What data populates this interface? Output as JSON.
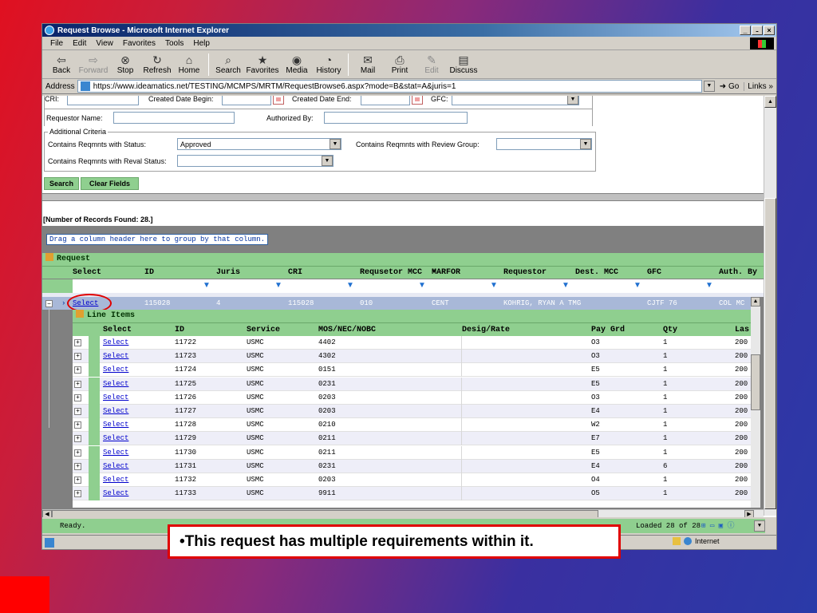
{
  "window": {
    "title": "Request Browse - Microsoft Internet Explorer",
    "controls": [
      "_",
      "̵",
      "×"
    ]
  },
  "menu": [
    "File",
    "Edit",
    "View",
    "Favorites",
    "Tools",
    "Help"
  ],
  "toolbar": {
    "back": "Back",
    "forward": "Forward",
    "stop": "Stop",
    "refresh": "Refresh",
    "home": "Home",
    "search": "Search",
    "favorites": "Favorites",
    "media": "Media",
    "history": "History",
    "mail": "Mail",
    "print": "Print",
    "edit": "Edit",
    "discuss": "Discuss"
  },
  "address": {
    "label": "Address",
    "url": "https://www.ideamatics.net/TESTING/MCMPS/MRTM/RequestBrowse6.aspx?mode=B&stat=A&juris=1",
    "go": "Go",
    "links": "Links"
  },
  "form": {
    "cri_label": "CRI:",
    "created_begin_label": "Created Date Begin:",
    "created_end_label": "Created Date End:",
    "gfc_label": "GFC:",
    "requestor_label": "Requestor Name:",
    "authorized_label": "Authorized By:",
    "additional_legend": "Additional Criteria",
    "status_label": "Contains Reqmnts with Status:",
    "status_value": "Approved",
    "review_label": "Contains Reqmnts with Review Group:",
    "reval_label": "Contains Reqmnts with Reval Status:",
    "search_button": "Search",
    "clear_button": "Clear Fields"
  },
  "records_found": "[Number of Records Found: 28.]",
  "grid": {
    "group_hint": "Drag a column header here to group by that column.",
    "band_title": "Request",
    "columns": [
      "Select",
      "ID",
      "Juris",
      "CRI",
      "Requsetor MCC",
      "MARFOR",
      "Requestor",
      "Dest. MCC",
      "GFC",
      "Auth. By"
    ],
    "selected_row": {
      "select": "Select",
      "id": "115028",
      "juris": "4",
      "cri": "115028",
      "mcc": "010",
      "marfor": "CENT",
      "requestor": "KOHRIG, RYAN A TMG",
      "gfc": "CJTF 76",
      "auth": "COL MC"
    }
  },
  "line_items": {
    "title": "Line Items",
    "columns": [
      "Select",
      "ID",
      "Service",
      "MOS/NEC/NOBC",
      "Desig/Rate",
      "Pay Grd",
      "Qty",
      "Las"
    ],
    "rows": [
      {
        "select": "Select",
        "id": "11722",
        "service": "USMC",
        "mos": "4402",
        "pay": "O3",
        "qty": "1",
        "last": "200"
      },
      {
        "select": "Select",
        "id": "11723",
        "service": "USMC",
        "mos": "4302",
        "pay": "O3",
        "qty": "1",
        "last": "200"
      },
      {
        "select": "Select",
        "id": "11724",
        "service": "USMC",
        "mos": "0151",
        "pay": "E5",
        "qty": "1",
        "last": "200"
      },
      {
        "select": "Select",
        "id": "11725",
        "service": "USMC",
        "mos": "0231",
        "pay": "E5",
        "qty": "1",
        "last": "200"
      },
      {
        "select": "Select",
        "id": "11726",
        "service": "USMC",
        "mos": "0203",
        "pay": "O3",
        "qty": "1",
        "last": "200"
      },
      {
        "select": "Select",
        "id": "11727",
        "service": "USMC",
        "mos": "0203",
        "pay": "E4",
        "qty": "1",
        "last": "200"
      },
      {
        "select": "Select",
        "id": "11728",
        "service": "USMC",
        "mos": "0210",
        "pay": "W2",
        "qty": "1",
        "last": "200"
      },
      {
        "select": "Select",
        "id": "11729",
        "service": "USMC",
        "mos": "0211",
        "pay": "E7",
        "qty": "1",
        "last": "200"
      },
      {
        "select": "Select",
        "id": "11730",
        "service": "USMC",
        "mos": "0211",
        "pay": "E5",
        "qty": "1",
        "last": "200"
      },
      {
        "select": "Select",
        "id": "11731",
        "service": "USMC",
        "mos": "0231",
        "pay": "E4",
        "qty": "6",
        "last": "200"
      },
      {
        "select": "Select",
        "id": "11732",
        "service": "USMC",
        "mos": "0203",
        "pay": "O4",
        "qty": "1",
        "last": "200"
      },
      {
        "select": "Select",
        "id": "11733",
        "service": "USMC",
        "mos": "9911",
        "pay": "O5",
        "qty": "1",
        "last": "200"
      }
    ]
  },
  "status": {
    "grid_ready": "Ready.",
    "grid_loaded": "Loaded 28 of 28",
    "zone": "Internet"
  },
  "caption": "•This request has multiple requirements within it.",
  "colors": {
    "grid_green": "#8fcf8f",
    "highlight_circle": "#e00000"
  }
}
